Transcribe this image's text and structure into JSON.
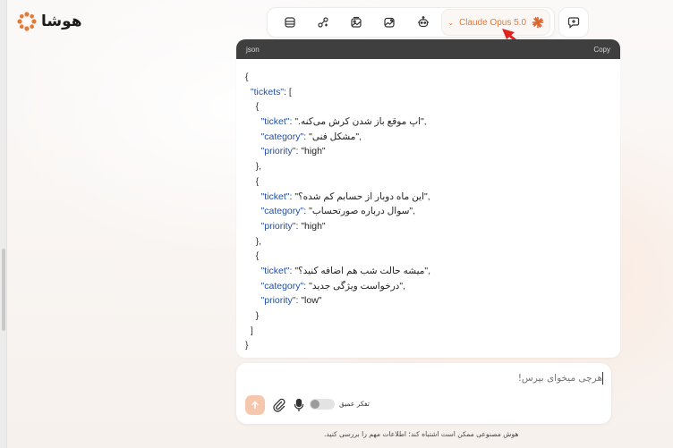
{
  "brand": {
    "name": "هوشا"
  },
  "toolbar": {
    "tools": [
      "database-icon",
      "workflow-icon",
      "image-gallery-icon",
      "image-edit-icon",
      "robot-icon"
    ],
    "model_name": "Claude Opus 5.0",
    "model_chevron": "⌄"
  },
  "code_block": {
    "language": "json",
    "copy_label": "Copy",
    "lines": [
      {
        "indent": "",
        "parts": [
          [
            "p",
            "{"
          ]
        ]
      },
      {
        "indent": "  ",
        "parts": [
          [
            "k",
            "\"tickets\""
          ],
          [
            "p",
            ": ["
          ]
        ]
      },
      {
        "indent": "    ",
        "parts": [
          [
            "p",
            "{"
          ]
        ]
      },
      {
        "indent": "      ",
        "parts": [
          [
            "k",
            "\"ticket\""
          ],
          [
            "p",
            ": "
          ],
          [
            "s",
            "\"اپ موقع باز شدن کرش می‌کنه.\""
          ],
          [
            "p",
            ","
          ]
        ]
      },
      {
        "indent": "      ",
        "parts": [
          [
            "k",
            "\"category\""
          ],
          [
            "p",
            ": "
          ],
          [
            "s",
            "\"مشکل فنی\""
          ],
          [
            "p",
            ","
          ]
        ]
      },
      {
        "indent": "      ",
        "parts": [
          [
            "k",
            "\"priority\""
          ],
          [
            "p",
            ": "
          ],
          [
            "v",
            "\"high\""
          ]
        ]
      },
      {
        "indent": "    ",
        "parts": [
          [
            "p",
            "},"
          ]
        ]
      },
      {
        "indent": "    ",
        "parts": [
          [
            "p",
            "{"
          ]
        ]
      },
      {
        "indent": "      ",
        "parts": [
          [
            "k",
            "\"ticket\""
          ],
          [
            "p",
            ": "
          ],
          [
            "s",
            "\"این ماه دوبار از حسابم کم شده؟\""
          ],
          [
            "p",
            ","
          ]
        ]
      },
      {
        "indent": "      ",
        "parts": [
          [
            "k",
            "\"category\""
          ],
          [
            "p",
            ": "
          ],
          [
            "s",
            "\"سوال درباره صورتحساب\""
          ],
          [
            "p",
            ","
          ]
        ]
      },
      {
        "indent": "      ",
        "parts": [
          [
            "k",
            "\"priority\""
          ],
          [
            "p",
            ": "
          ],
          [
            "v",
            "\"high\""
          ]
        ]
      },
      {
        "indent": "    ",
        "parts": [
          [
            "p",
            "},"
          ]
        ]
      },
      {
        "indent": "    ",
        "parts": [
          [
            "p",
            "{"
          ]
        ]
      },
      {
        "indent": "      ",
        "parts": [
          [
            "k",
            "\"ticket\""
          ],
          [
            "p",
            ": "
          ],
          [
            "s",
            "\"میشه حالت شب هم اضافه کنید؟\""
          ],
          [
            "p",
            ","
          ]
        ]
      },
      {
        "indent": "      ",
        "parts": [
          [
            "k",
            "\"category\""
          ],
          [
            "p",
            ": "
          ],
          [
            "s",
            "\"درخواست ویژگی جدید\""
          ],
          [
            "p",
            ","
          ]
        ]
      },
      {
        "indent": "      ",
        "parts": [
          [
            "k",
            "\"priority\""
          ],
          [
            "p",
            ": "
          ],
          [
            "v",
            "\"low\""
          ]
        ]
      },
      {
        "indent": "    ",
        "parts": [
          [
            "p",
            "}"
          ]
        ]
      },
      {
        "indent": "  ",
        "parts": [
          [
            "p",
            "]"
          ]
        ]
      },
      {
        "indent": "",
        "parts": [
          [
            "p",
            "}"
          ]
        ]
      }
    ]
  },
  "composer": {
    "placeholder": "هرچی میخوای بپرس!",
    "deep_think_label": "تفکر عمیق",
    "deep_think_enabled": false
  },
  "disclaimer": "هوش مصنوعی ممکن است اشتباه کند؛ اطلاعات مهم را بررسی کنید.",
  "colors": {
    "accent": "#e07b39",
    "code_header": "#3f3f3f",
    "json_key": "#1f4fa8",
    "annotation_arrow": "#e0241d"
  }
}
